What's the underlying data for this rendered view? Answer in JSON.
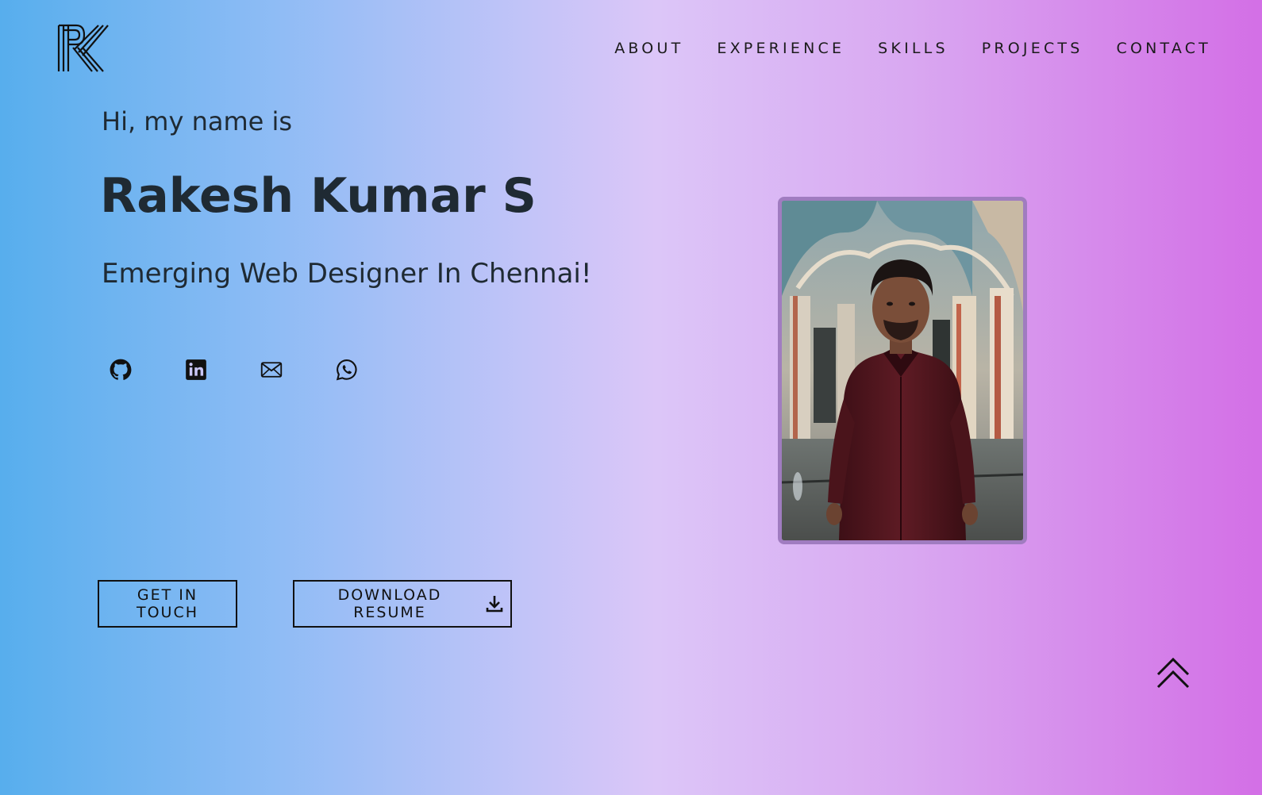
{
  "logo": {
    "alt": "RK",
    "icon": "rk-monogram-logo"
  },
  "nav": {
    "items": [
      {
        "label": "ABOUT"
      },
      {
        "label": "EXPERIENCE"
      },
      {
        "label": "SKILLS"
      },
      {
        "label": "PROJECTS"
      },
      {
        "label": "CONTACT"
      }
    ]
  },
  "hero": {
    "greeting": "Hi, my name is",
    "name": "Rakesh Kumar S",
    "tagline": "Emerging Web Designer In Chennai!"
  },
  "socials": [
    {
      "icon": "github-icon"
    },
    {
      "icon": "linkedin-icon"
    },
    {
      "icon": "mail-icon"
    },
    {
      "icon": "whatsapp-icon"
    }
  ],
  "buttons": {
    "get_in_touch": "GET IN TOUCH",
    "download_resume": "DOWNLOAD RESUME"
  },
  "photo": {
    "alt": "Rakesh Kumar S portrait photo"
  },
  "back_to_top": {
    "icon": "double-chevron-up-icon"
  },
  "colors": {
    "gradient_start": "#57aeed",
    "gradient_mid": "#dcc6f8",
    "gradient_end": "#d36fe6",
    "text": "#1f2a33",
    "photo_border": "#a07cc0"
  }
}
